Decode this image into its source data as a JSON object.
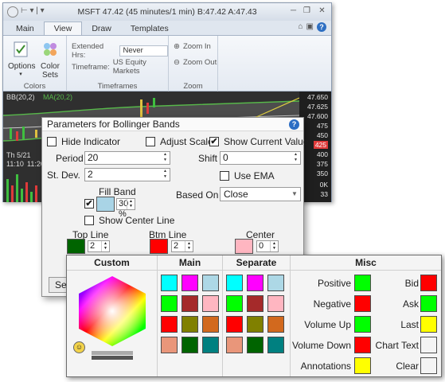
{
  "app": {
    "title": "MSFT 47.42 (45 minutes/1 min) B:47.42 A:47.43",
    "tabs": [
      "Main",
      "View",
      "Draw",
      "Templates"
    ],
    "active_tab": "View",
    "ribbon": {
      "options_label": "Options",
      "color_sets_label": "Color Sets",
      "colors_group": "Colors",
      "extended_hrs_label": "Extended Hrs:",
      "extended_hrs_value": "Never",
      "timeframe_label": "Timeframe:",
      "timeframe_value": "US Equity Markets",
      "timeframes_group": "Timeframes",
      "zoom_in": "Zoom In",
      "zoom_out": "Zoom Out",
      "zoom_group": "Zoom"
    },
    "chart": {
      "indicator_label": "BB(20,2)",
      "ma_label": "MA(20,2)",
      "prices": [
        "47.650",
        "47.625",
        "47.600",
        "475",
        "450",
        "425",
        "400",
        "375",
        "350"
      ],
      "date_label": "Th 5/21",
      "times": [
        "11:10",
        "11:20"
      ],
      "vol_labels": [
        "0K",
        "33"
      ]
    }
  },
  "dialog": {
    "title": "Parameters for Bollinger Bands",
    "hide_indicator": "Hide Indicator",
    "adjust_scale": "Adjust Scale",
    "show_current_value": "Show Current Value",
    "period_label": "Period",
    "period_value": "20",
    "shift_label": "Shift",
    "shift_value": "0",
    "stdev_label": "St. Dev.",
    "stdev_value": "2",
    "use_ema": "Use EMA",
    "fill_band": "Fill Band",
    "fill_pct": "30 %",
    "based_on_label": "Based On",
    "based_on_value": "Close",
    "show_center_line": "Show Center Line",
    "top_line": "Top Line",
    "top_line_width": "2",
    "btm_line": "Btm Line",
    "btm_line_width": "2",
    "center": "Center",
    "center_width": "0",
    "set_button": "Se",
    "hide_indicator_checked": false,
    "adjust_scale_checked": false,
    "show_current_value_checked": true,
    "use_ema_checked": false,
    "fill_band_checked": true,
    "show_center_line_checked": false,
    "colors": {
      "fill_band": "#a9d4e6",
      "top_line": "#006400",
      "btm_line": "#ff0000",
      "center": "#ffb6c1"
    }
  },
  "palette": {
    "headers": {
      "custom": "Custom",
      "main": "Main",
      "separate": "Separate",
      "misc": "Misc"
    },
    "main_colors": [
      "#00ffff",
      "#ff00ff",
      "#add8e6",
      "#00ff00",
      "#a52a2a",
      "#ffb6c1",
      "#ff0000",
      "#808000",
      "#d2691e",
      "#e9967a",
      "#006400",
      "#008080"
    ],
    "separate_colors": [
      "#00ffff",
      "#ff00ff",
      "#add8e6",
      "#00ff00",
      "#a52a2a",
      "#ffb6c1",
      "#ff0000",
      "#808000",
      "#d2691e",
      "#e9967a",
      "#006400",
      "#008080"
    ],
    "misc_left": [
      {
        "label": "Positive",
        "color": "#00ff00"
      },
      {
        "label": "Negative",
        "color": "#ff0000"
      },
      {
        "label": "Volume Up",
        "color": "#00ff00"
      },
      {
        "label": "Volume Down",
        "color": "#ff0000"
      },
      {
        "label": "Annotations",
        "color": "#ffff00"
      }
    ],
    "misc_right": [
      {
        "label": "Bid",
        "color": "#ff0000"
      },
      {
        "label": "Ask",
        "color": "#00ff00"
      },
      {
        "label": "Last",
        "color": "#ffff00"
      },
      {
        "label": "Chart Text",
        "color": "#f4f4f4"
      },
      {
        "label": "Clear",
        "color": "#f4f4f4"
      }
    ]
  }
}
